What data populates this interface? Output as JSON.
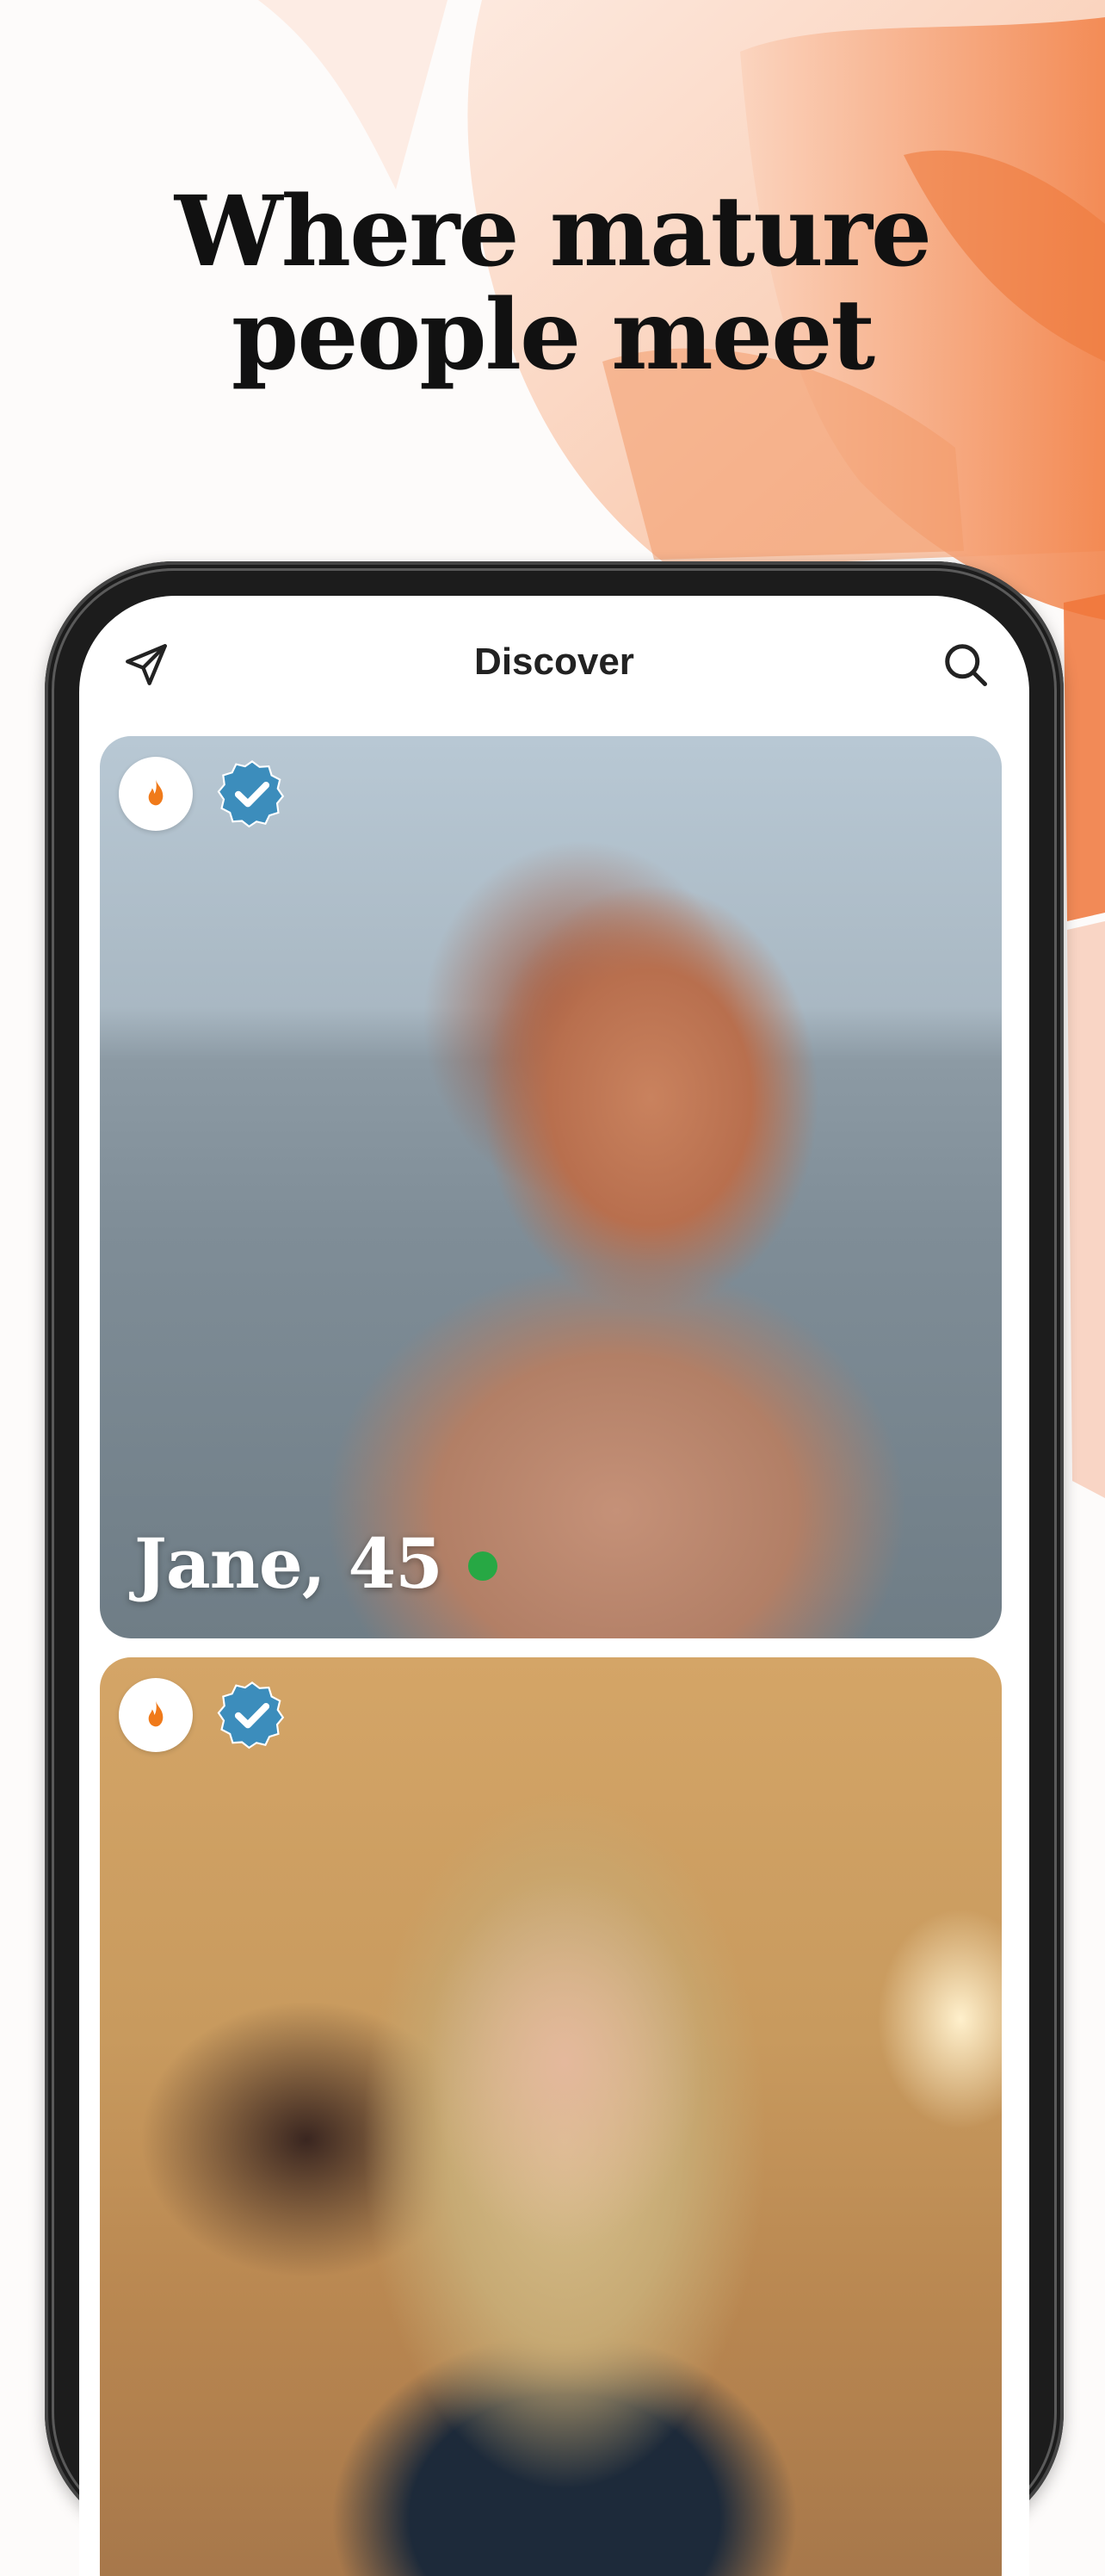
{
  "headline": {
    "line1": "Where mature",
    "line2": "people meet"
  },
  "app": {
    "header": {
      "title": "Discover",
      "left_icon": "send-icon",
      "right_icon": "search-icon"
    },
    "profiles": [
      {
        "name_age": "Jane, 45",
        "online": true,
        "badges": [
          "flame-icon",
          "verified-icon"
        ]
      },
      {
        "name_age": "",
        "online": false,
        "badges": [
          "flame-icon",
          "verified-icon"
        ]
      }
    ]
  },
  "colors": {
    "flame": "#f07a1a",
    "verified": "#3c8dbc",
    "online": "#27a844",
    "accent_paint": "#f28a52"
  }
}
